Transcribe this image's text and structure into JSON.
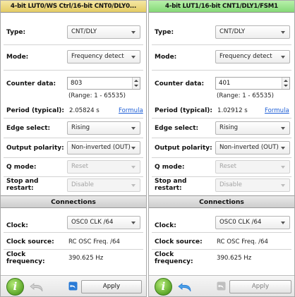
{
  "panels": [
    {
      "title": "4-bit LUT0/WS Ctrl/16-bit CNT0/DLY0...",
      "type_label": "Type:",
      "type_value": "CNT/DLY",
      "mode_label": "Mode:",
      "mode_value": "Frequency detect",
      "counter_label": "Counter data:",
      "counter_value": "803",
      "range_text": "(Range:  1 - 65535)",
      "period_label": "Period (typical):",
      "period_value": "2.05824 s",
      "formula_link": "Formula",
      "edge_label": "Edge select:",
      "edge_value": "Rising",
      "polarity_label": "Output polarity:",
      "polarity_value": "Non-inverted (OUT)",
      "qmode_label": "Q mode:",
      "qmode_value": "Reset",
      "stop_label_1": "Stop and",
      "stop_label_2": "restart:",
      "stop_value": "Disable",
      "connections_label": "Connections",
      "clock_label": "Clock:",
      "clock_value": "OSC0 CLK /64",
      "clock_source_label": "Clock source:",
      "clock_source_value": "RC OSC Freq. /64",
      "clock_freq_label_1": "Clock",
      "clock_freq_label_2": "frequency:",
      "clock_freq_value": "390.625 Hz",
      "apply_label": "Apply"
    },
    {
      "title": "4-bit LUT1/16-bit CNT1/DLY1/FSM1",
      "type_label": "Type:",
      "type_value": "CNT/DLY",
      "mode_label": "Mode:",
      "mode_value": "Frequency detect",
      "counter_label": "Counter data:",
      "counter_value": "401",
      "range_text": "(Range:  1 - 65535)",
      "period_label": "Period (typical):",
      "period_value": "1.02912 s",
      "formula_link": "Formula",
      "edge_label": "Edge select:",
      "edge_value": "Rising",
      "polarity_label": "Output polarity:",
      "polarity_value": "Non-inverted (OUT)",
      "qmode_label": "Q mode:",
      "qmode_value": "Reset",
      "stop_label_1": "Stop and",
      "stop_label_2": "restart:",
      "stop_value": "Disable",
      "connections_label": "Connections",
      "clock_label": "Clock:",
      "clock_value": "OSC0 CLK /64",
      "clock_source_label": "Clock source:",
      "clock_source_value": "RC OSC Freq. /64",
      "clock_freq_label_1": "Clock",
      "clock_freq_label_2": "frequency:",
      "clock_freq_value": "390.625 Hz",
      "apply_label": "Apply"
    }
  ],
  "icons": {
    "info": "info-icon",
    "undo": "undo-icon",
    "info_glyph": "i"
  },
  "colors": {
    "left_header": "#e5cc64",
    "right_header": "#85d977",
    "link": "#1f5fd6",
    "undo_blue": "#2a7bd6"
  }
}
